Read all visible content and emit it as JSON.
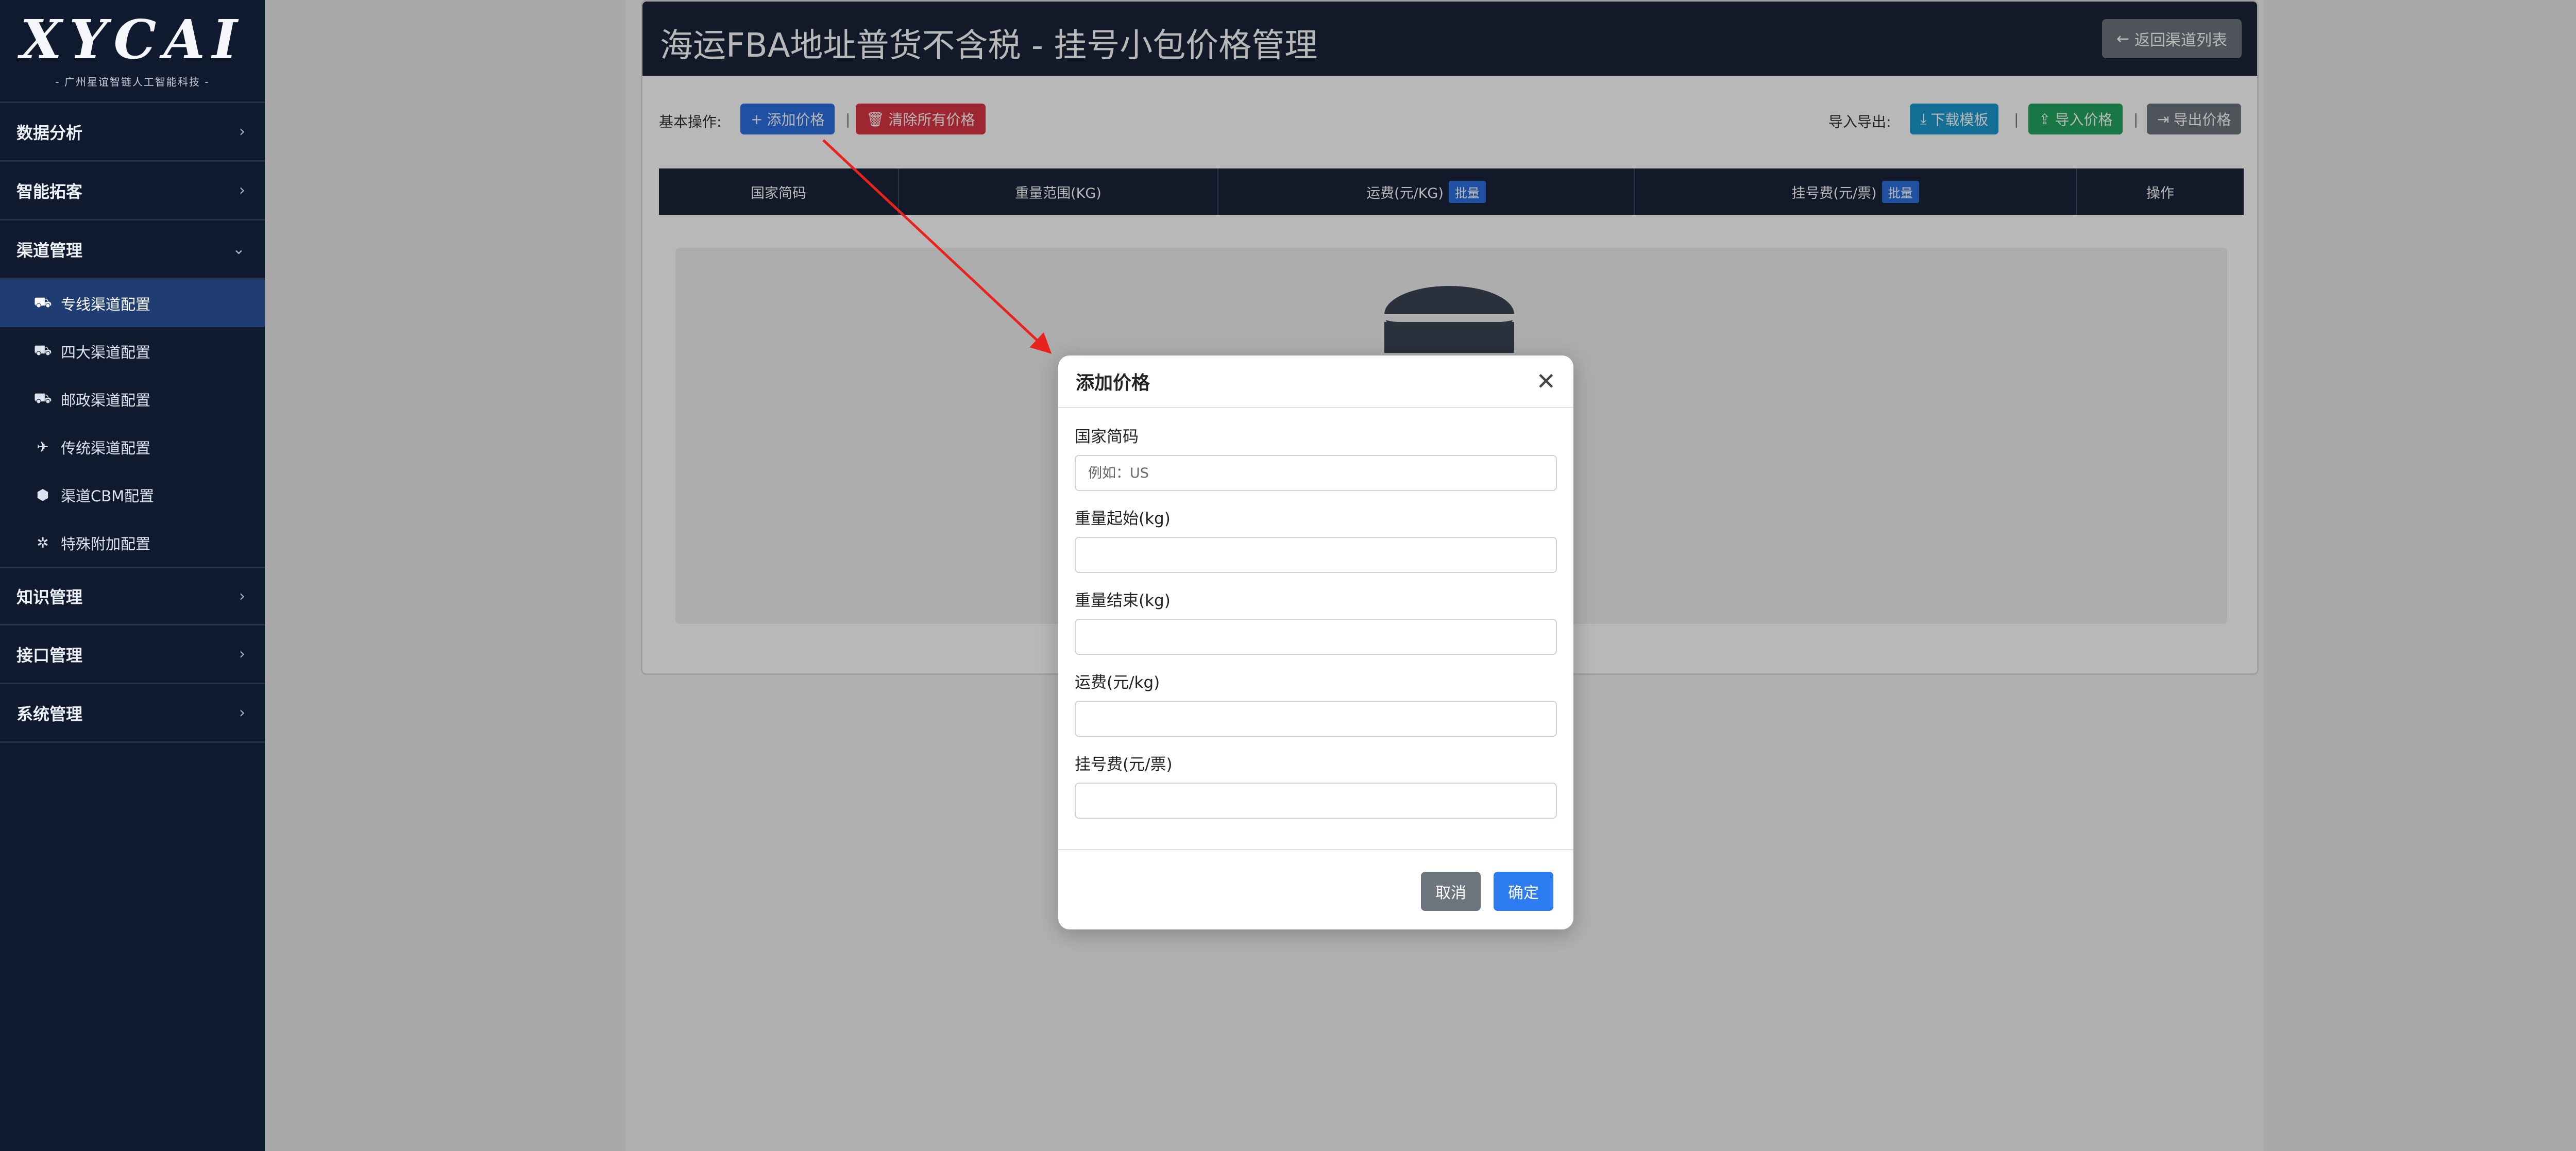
{
  "brand": {
    "logo": "XYCAI",
    "subtitle": "- 广州星谊智链人工智能科技 -"
  },
  "sidebar": {
    "groups_top": [
      {
        "label": "数据分析",
        "chevron": "›"
      },
      {
        "label": "智能拓客",
        "chevron": "›"
      },
      {
        "label": "渠道管理",
        "chevron": "⌄"
      }
    ],
    "channel_items": [
      {
        "label": "专线渠道配置",
        "icon": "truck-icon",
        "glyph": "⛟",
        "active": true
      },
      {
        "label": "四大渠道配置",
        "icon": "truck-icon",
        "glyph": "⛟"
      },
      {
        "label": "邮政渠道配置",
        "icon": "truck-icon",
        "glyph": "⛟"
      },
      {
        "label": "传统渠道配置",
        "icon": "plane-icon",
        "glyph": "✈"
      },
      {
        "label": "渠道CBM配置",
        "icon": "box-icon",
        "glyph": "⬢"
      },
      {
        "label": "特殊附加配置",
        "icon": "gear-icon",
        "glyph": "✲"
      }
    ],
    "groups_bottom": [
      {
        "label": "知识管理",
        "chevron": "›"
      },
      {
        "label": "接口管理",
        "chevron": "›"
      },
      {
        "label": "系统管理",
        "chevron": "›"
      }
    ]
  },
  "header": {
    "title": "海运FBA地址普货不含税 - 挂号小包价格管理",
    "back_label": "返回渠道列表",
    "back_icon": "←"
  },
  "toolbar": {
    "basic_label": "基本操作:",
    "add_price": "添加价格",
    "add_icon": "+",
    "clear_all": "清除所有价格",
    "clear_icon": "🗑",
    "sep": "|",
    "io_label": "导入导出:",
    "download_template": "下载模板",
    "download_icon": "⤓",
    "import_price": "导入价格",
    "import_icon": "⇪",
    "export_price": "导出价格",
    "export_icon": "⇥"
  },
  "table": {
    "headers": [
      "国家简码",
      "重量范围(KG)",
      "运费(元/KG)",
      "挂号费(元/票)",
      "操作"
    ],
    "batch_badge": "批量"
  },
  "modal": {
    "title": "添加价格",
    "close_glyph": "✕",
    "fields": [
      {
        "label": "国家简码",
        "placeholder": "例如：US"
      },
      {
        "label": "重量起始(kg)",
        "placeholder": ""
      },
      {
        "label": "重量结束(kg)",
        "placeholder": ""
      },
      {
        "label": "运费(元/kg)",
        "placeholder": ""
      },
      {
        "label": "挂号费(元/票)",
        "placeholder": ""
      }
    ],
    "cancel": "取消",
    "confirm": "确定"
  },
  "colors": {
    "sidebar_bg": "#101a2f",
    "active_item": "#1f3c73",
    "header_bg": "#1a2339",
    "primary": "#2d6fe0",
    "danger": "#dc3545",
    "success": "#23a660",
    "info": "#1b9ad0",
    "secondary": "#6c757d",
    "annotation_arrow": "#e8231d"
  }
}
